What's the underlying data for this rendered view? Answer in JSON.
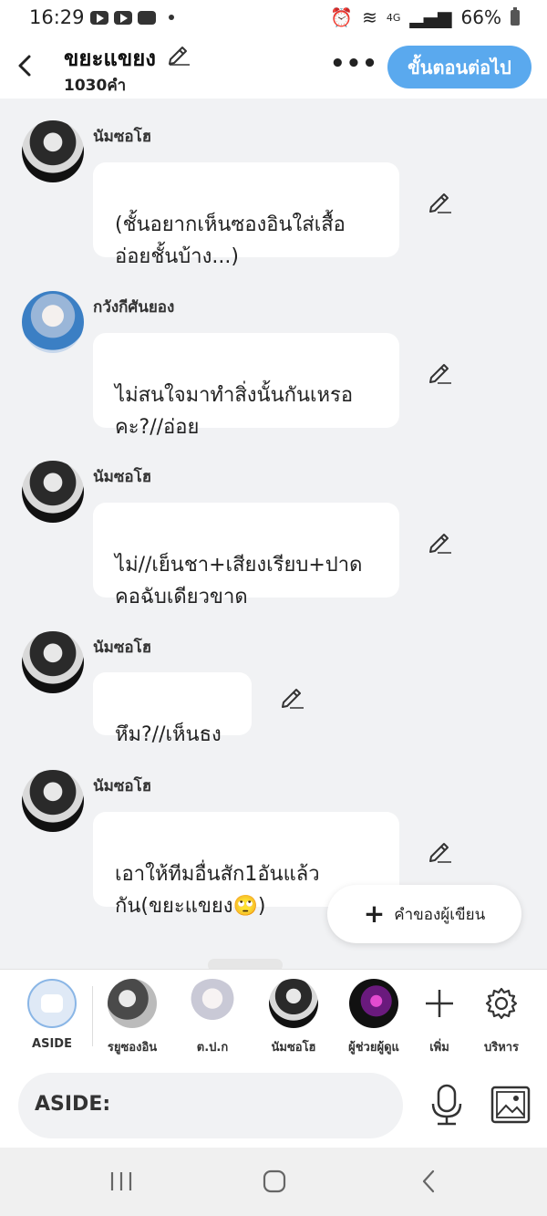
{
  "status_bar": {
    "time": "16:29",
    "battery": "66%",
    "network": "4G"
  },
  "header": {
    "title": "ขยะแขยง",
    "word_count": "1030คำ",
    "more_label": "•••",
    "next_button": "ขั้นตอนต่อไป"
  },
  "messages": [
    {
      "sender": "นัมซอโฮ",
      "text": "(ชั้นอยากเห็นซองอินใส่เสื้อ\nอ่อยชั้นบ้าง...)"
    },
    {
      "sender": "กวังกีศันยอง",
      "text": "ไม่สนใจมาทำสิ่งนั้นกันเหรอ\nคะ?//อ่อย"
    },
    {
      "sender": "นัมซอโฮ",
      "text": "ไม่//เย็นชา+เสียงเรียบ+ปาด\nคอฉับเดียวขาด"
    },
    {
      "sender": "นัมซอโฮ",
      "text": "หึม?//เห็นธง"
    },
    {
      "sender": "นัมซอโฮ",
      "text": "เอาให้ทีมอื่นสัก1อันแล้ว\nกัน(ขยะแขยง🙄)"
    }
  ],
  "fab": {
    "label": "คำของผู้เขียน"
  },
  "characters": [
    {
      "label": "ASIDE"
    },
    {
      "label": "รยูซองอิน"
    },
    {
      "label": "ต.ป.ก"
    },
    {
      "label": "นัมซอโฮ"
    },
    {
      "label": "ผู้ช่วยผู้ดูแ"
    },
    {
      "label": "เพิ่ม"
    },
    {
      "label": "บริหาร"
    }
  ],
  "input": {
    "label": "ASIDE:",
    "value": ""
  },
  "colors": {
    "accent": "#5aa9ee",
    "background": "#f1f2f4"
  },
  "icons": [
    "back-icon",
    "edit-pencil-icon",
    "more-icon",
    "plus-icon",
    "gear-icon",
    "microphone-icon",
    "image-icon",
    "nav-recents-icon",
    "nav-home-icon",
    "nav-back-icon"
  ]
}
